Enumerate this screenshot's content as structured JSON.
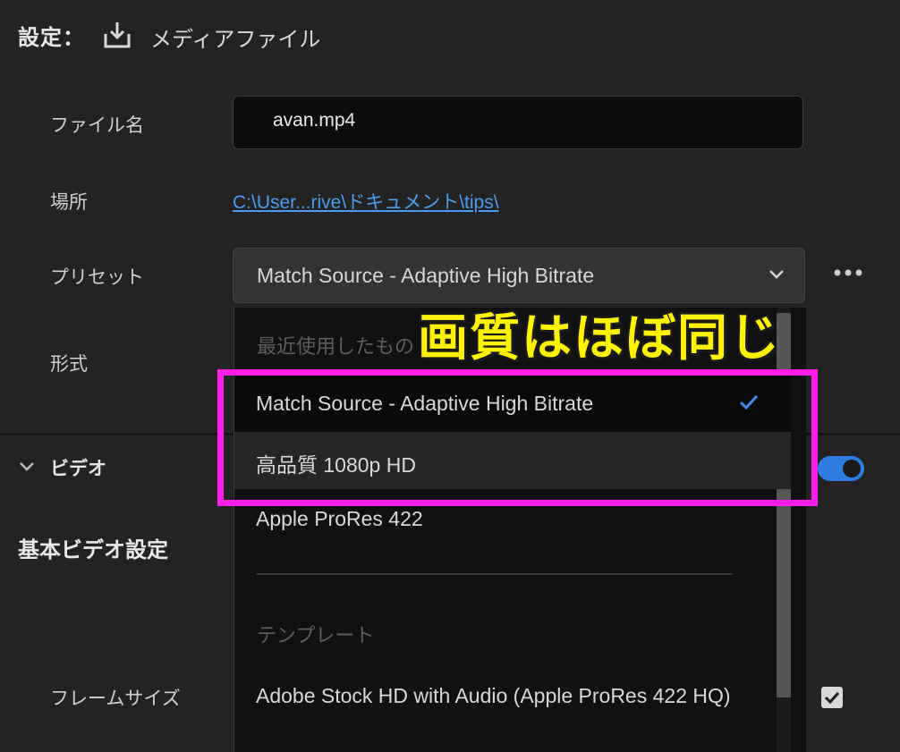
{
  "header": {
    "settings_label": "設定：",
    "export_icon": "download-icon",
    "destination": "メディアファイル"
  },
  "fields": {
    "filename": {
      "label": "ファイル名",
      "value": "avan.mp4"
    },
    "location": {
      "label": "場所",
      "value": "C:\\User...rive\\ドキュメント\\tips\\"
    },
    "preset": {
      "label": "プリセット",
      "value": "Match Source - Adaptive High Bitrate",
      "icon": "chevron-down-icon"
    },
    "format": {
      "label": "形式"
    }
  },
  "more_icon": "more-horizontal-icon",
  "video_section": {
    "label": "ビデオ",
    "icon": "chevron-down-icon",
    "enabled": true,
    "accent": "#2f7de1"
  },
  "basic_video_settings": {
    "title": "基本ビデオ設定",
    "frame_size_label": "フレームサイズ",
    "checkbox_checked": true
  },
  "preset_dropdown": {
    "recent_header": "最近使用したもの",
    "recent_items": [
      {
        "label": "Match Source - Adaptive High Bitrate",
        "selected": true
      },
      {
        "label": "高品質 1080p HD",
        "selected": false
      },
      {
        "label": "Apple ProRes 422",
        "selected": false
      }
    ],
    "templates_header": "テンプレート",
    "template_items": [
      {
        "label": "Adobe Stock HD with Audio (Apple ProRes 422 HQ)"
      }
    ],
    "check_icon": "checkmark-icon"
  },
  "annotation": {
    "text": "画質はほぼ同じ",
    "color": "#ff1ee8",
    "text_color": "#fff200"
  }
}
